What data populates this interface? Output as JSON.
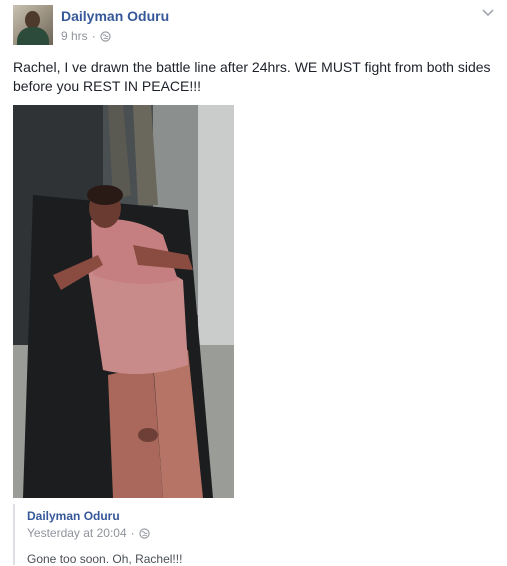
{
  "post": {
    "author": "Dailyman Oduru",
    "time": "9 hrs",
    "separator": "·",
    "privacy_icon": "globe-icon",
    "options_icon": "chevron-down-icon",
    "text": "Rachel, I ve drawn the battle line after 24hrs. WE MUST fight from both sides before you REST IN PEACE!!!"
  },
  "shared": {
    "author": "Dailyman Oduru",
    "time": "Yesterday at 20:04",
    "separator": "·",
    "privacy_icon": "globe-icon",
    "text": "Gone too soon. Oh, Rachel!!!"
  },
  "colors": {
    "link": "#365899",
    "meta": "#90949c",
    "text": "#1d2129"
  }
}
